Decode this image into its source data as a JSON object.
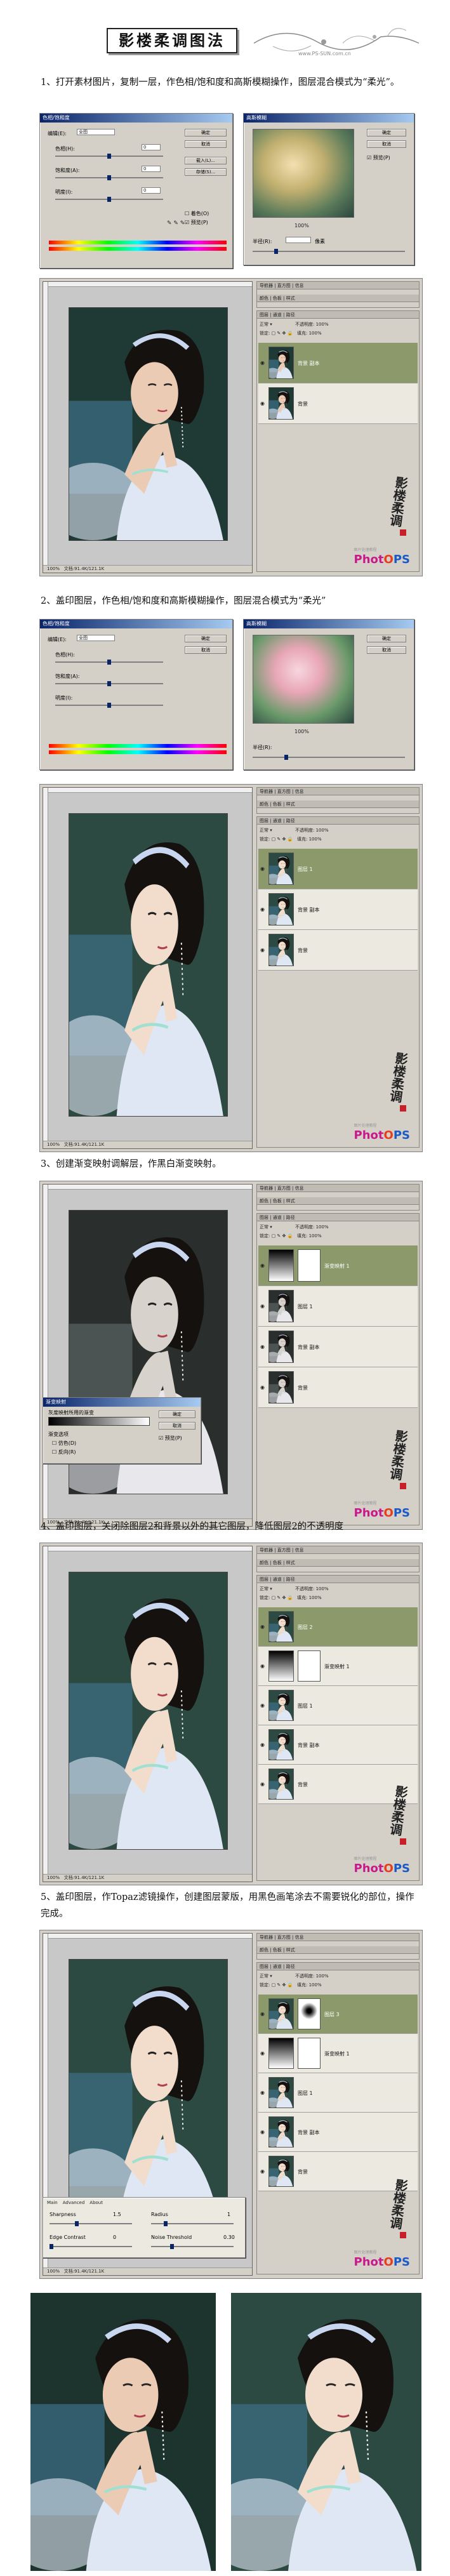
{
  "header": {
    "title": "影楼柔调图法",
    "url": "www.PS-SUN.com.cn"
  },
  "steps": [
    "1、打开素材图片，复制一层，作色相/饱和度和高斯模糊操作，图层混合模式为“柔光”。",
    "2、盖印图层，作色相/饱和度和高斯模糊操作，图层混合模式为“柔光”",
    "3、创建渐变映射调解层，作黑白渐变映射。",
    "4、盖印图层，关闭除图层2和背景以外的其它图层，降低图层2的不透明度",
    "5、盖印图层，作Topaz滤镜操作，创建图层蒙版，用黑色画笔涂去不需要锐化的部位，操作完成。"
  ],
  "hue_dialog": {
    "title": "色相/饱和度",
    "edit_label": "编辑(E):",
    "edit_value": "全图",
    "hue_label": "色相(H):",
    "hue_value": "0",
    "sat_label": "饱和度(A):",
    "sat_value": "0",
    "light_label": "明度(I):",
    "light_value": "0",
    "ok": "确定",
    "cancel": "取消",
    "load": "载入(L)...",
    "save": "存储(S)...",
    "colorize": "着色(O)",
    "preview": "预览(P)"
  },
  "blur_dialog": {
    "title": "高斯模糊",
    "ok": "确定",
    "cancel": "取消",
    "preview": "预览(P)",
    "zoom": "100%",
    "radius_label": "半径(R):",
    "radius_unit": "像素"
  },
  "ps_window": {
    "zoom": "100%",
    "doc_status": "文档:91.4K/121.1K",
    "panel_tabs": "导航器 | 直方图 | 信息",
    "panel_tabs2": "颜色 | 色板 | 样式",
    "layers_tabs": "图层 | 通道 | 路径",
    "blend_mode": "正常",
    "opacity_label": "不透明度:",
    "opacity_value": "100%",
    "lock_label": "锁定:",
    "fill_label": "填充:",
    "fill_value": "100%"
  },
  "layers": {
    "s1": [
      "背景 副本",
      "背景"
    ],
    "s2": [
      "图层 1",
      "背景 副本",
      "背景"
    ],
    "s3": [
      "渐变映射 1",
      "图层 1",
      "背景 副本",
      "背景"
    ],
    "s4": [
      "图层 2",
      "渐变映射 1",
      "图层 1",
      "背景 副本",
      "背景"
    ],
    "s5": [
      "图层 3",
      "渐变映射 1",
      "图层 1",
      "背景 副本",
      "背景"
    ]
  },
  "gradient_dialog": {
    "title": "渐变映射",
    "section": "灰度映射所用的渐变",
    "options": "渐变选项",
    "dither": "仿色(D)",
    "reverse": "反向(R)",
    "ok": "确定",
    "cancel": "取消",
    "preview": "预览(P)"
  },
  "topaz_dialog": {
    "tabs": [
      "Main",
      "Advanced",
      "About"
    ],
    "r1_label": "Sharpness",
    "r1_value": "1.5",
    "r2_label": "Radius",
    "r2_value": "1",
    "r3_label": "Edge Contrast",
    "r3_value": "0",
    "r4_label": "Noise Threshold",
    "r4_value": "0.30"
  },
  "watermark": {
    "signature": "影楼柔调",
    "site_small": "图片处理教程",
    "logo_p": "Phot",
    "logo_o": "O",
    "logo_s": "PS"
  },
  "colors": {
    "accent_layer": "#8c9a6b",
    "dialog_bg": "#d4d0c8",
    "photo_bg": "#1f3a35"
  }
}
